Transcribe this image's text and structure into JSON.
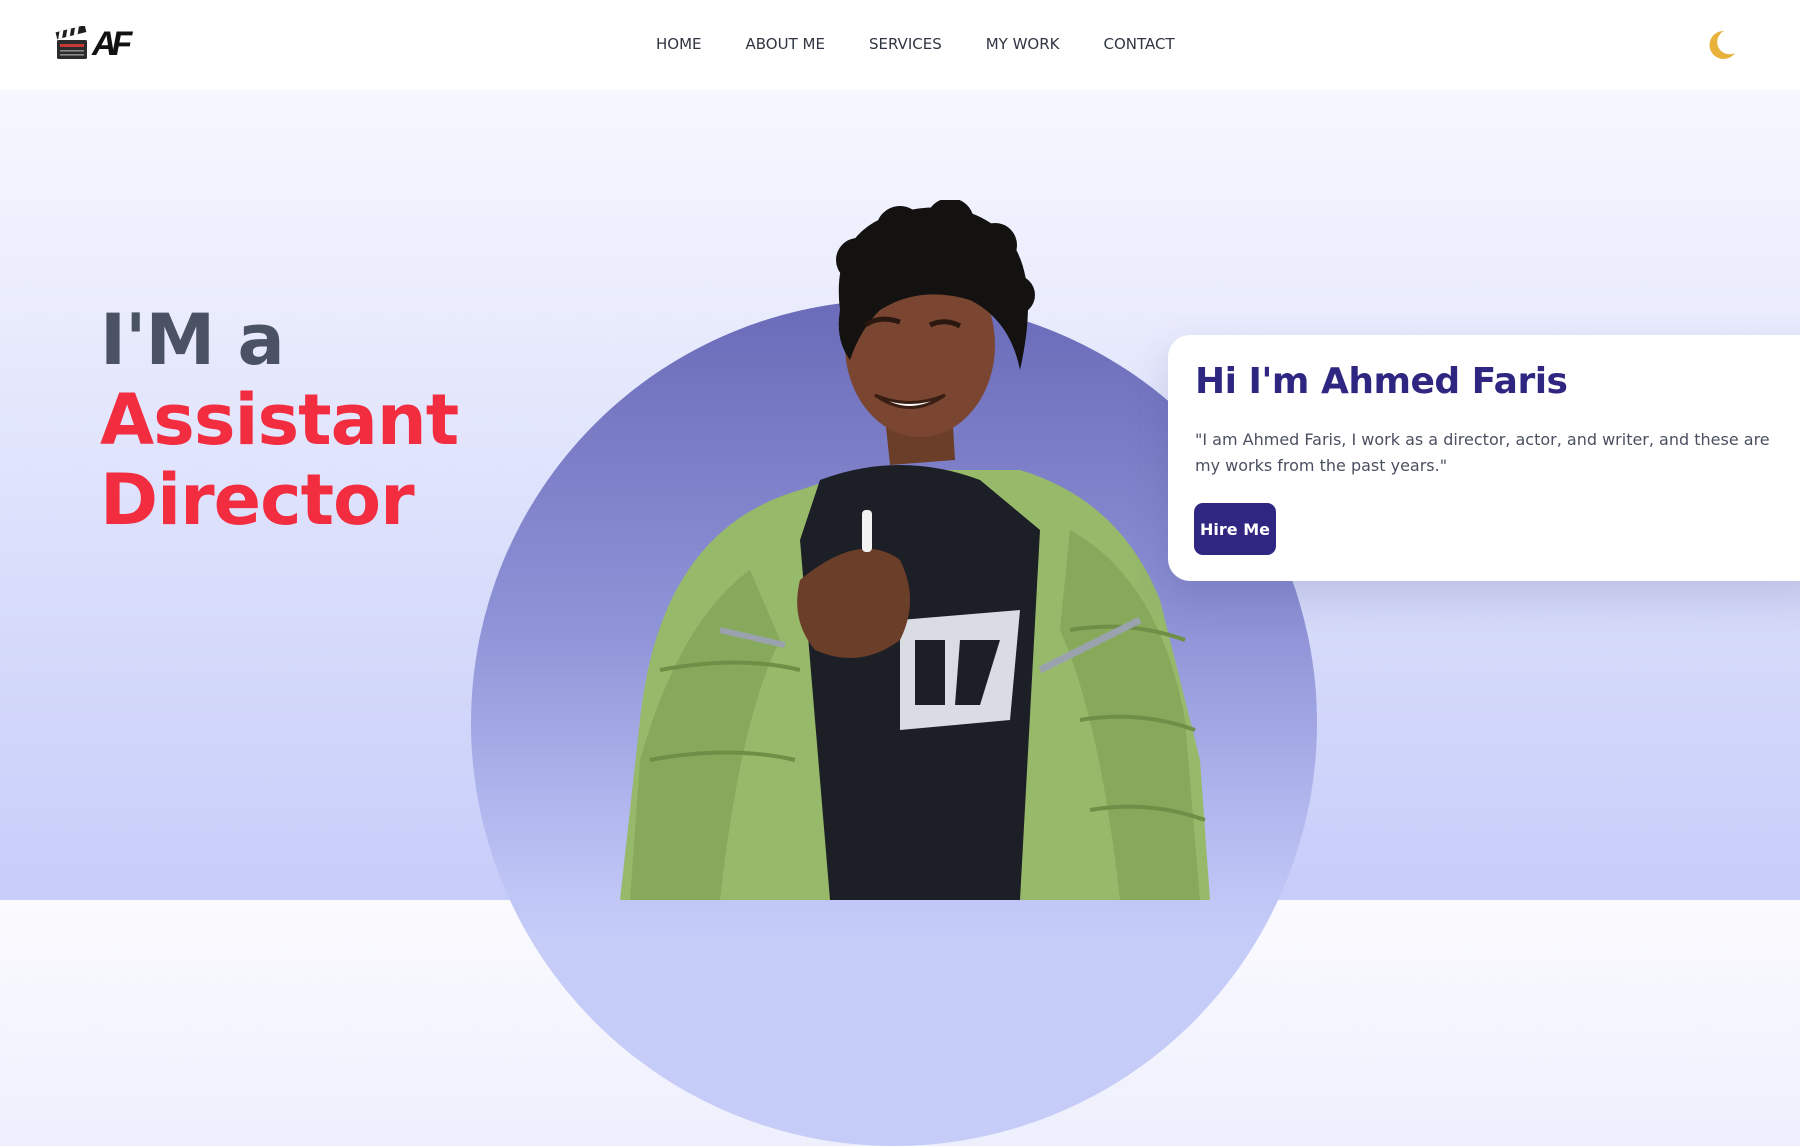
{
  "header": {
    "logo": {
      "mark_text": "AF",
      "icon": "clapperboard-icon"
    },
    "nav": [
      {
        "label": "HOME"
      },
      {
        "label": "ABOUT ME"
      },
      {
        "label": "SERVICES"
      },
      {
        "label": "MY WORK"
      },
      {
        "label": "CONTACT"
      }
    ],
    "theme_toggle_icon": "crescent-moon-icon"
  },
  "hero": {
    "line1": "I'M a",
    "role": "Assistant Director"
  },
  "intro_card": {
    "title": "Hi I'm Ahmed Faris",
    "text": "\"I am Ahmed Faris, I work as a director, actor, and writer, and these are my works from the past years.\"",
    "button_label": "Hire Me"
  },
  "colors": {
    "accent_red": "#f22d40",
    "primary_indigo": "#2e2681",
    "moon": "#e8b13c",
    "circle": "#7a7cc7"
  }
}
